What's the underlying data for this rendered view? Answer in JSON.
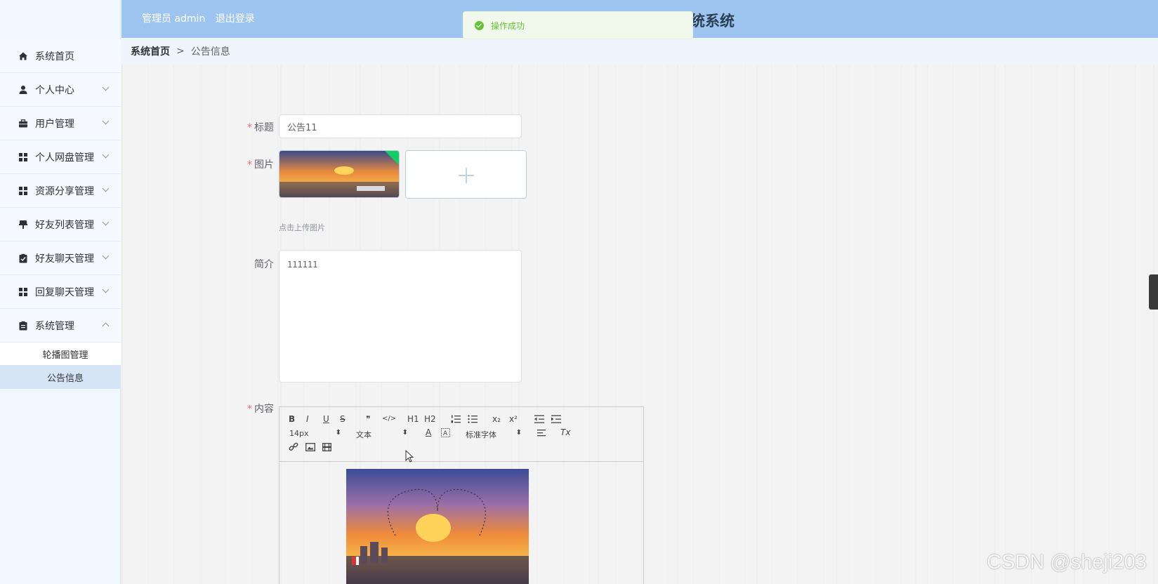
{
  "header": {
    "user_label": "管理员 admin",
    "logout_label": "退出登录",
    "title_fragment": "统系统"
  },
  "toast": {
    "message": "操作成功"
  },
  "breadcrumb": {
    "home": "系统首页",
    "separator": ">",
    "current": "公告信息"
  },
  "sidebar": {
    "items": [
      {
        "label": "系统首页",
        "icon": "home-icon"
      },
      {
        "label": "个人中心",
        "icon": "user-icon"
      },
      {
        "label": "用户管理",
        "icon": "briefcase-icon"
      },
      {
        "label": "个人网盘管理",
        "icon": "grid-icon"
      },
      {
        "label": "资源分享管理",
        "icon": "grid-icon"
      },
      {
        "label": "好友列表管理",
        "icon": "pin-icon"
      },
      {
        "label": "好友聊天管理",
        "icon": "clipboard-check-icon"
      },
      {
        "label": "回复聊天管理",
        "icon": "grid-icon"
      },
      {
        "label": "系统管理",
        "icon": "clipboard-icon"
      }
    ],
    "sub_items": [
      {
        "label": "轮播图管理"
      },
      {
        "label": "公告信息"
      }
    ]
  },
  "form": {
    "title_label": "标题",
    "title_value": "公告11",
    "image_label": "图片",
    "upload_hint": "点击上传图片",
    "intro_label": "简介",
    "intro_value": "111111",
    "content_label": "内容",
    "editor": {
      "bold": "B",
      "italic": "I",
      "underline": "U",
      "strike": "S",
      "quote": "❞",
      "code": "</>",
      "h1": "H1",
      "h2": "H2",
      "sub": "x₂",
      "sup": "x²",
      "size_select": "14px",
      "header_select": "文本",
      "font_select": "标准字体",
      "color": "A",
      "clear": "Tx"
    }
  },
  "watermark": "CSDN @sheji203",
  "colors": {
    "header_bg": "#9ec5ef",
    "sidebar_bg": "#f1f7fe",
    "success": "#67c23a",
    "required": "#f56c6c"
  }
}
